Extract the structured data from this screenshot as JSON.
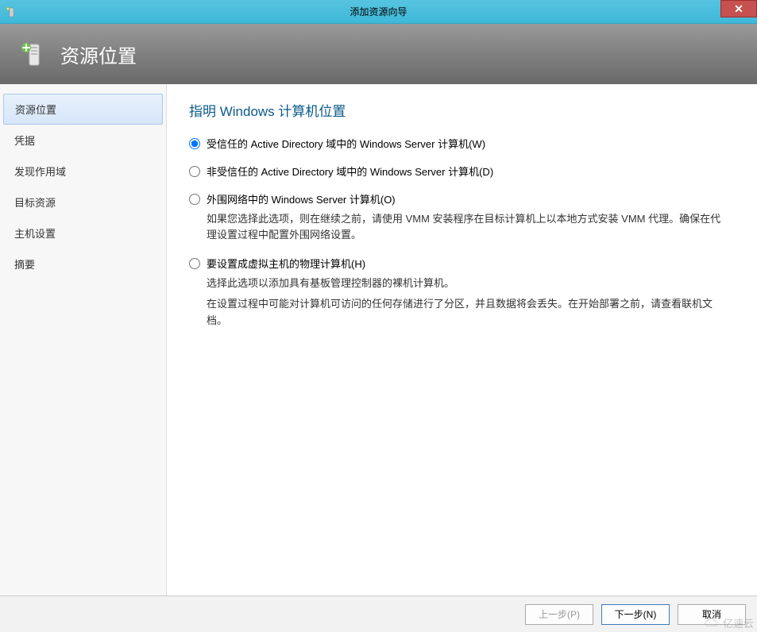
{
  "titlebar": {
    "title": "添加资源向导"
  },
  "header": {
    "title": "资源位置"
  },
  "sidebar": {
    "items": [
      {
        "label": "资源位置",
        "active": true
      },
      {
        "label": "凭据",
        "active": false
      },
      {
        "label": "发现作用域",
        "active": false
      },
      {
        "label": "目标资源",
        "active": false
      },
      {
        "label": "主机设置",
        "active": false
      },
      {
        "label": "摘要",
        "active": false
      }
    ]
  },
  "content": {
    "heading": "指明 Windows 计算机位置",
    "options": [
      {
        "label": "受信任的 Active Directory 域中的 Windows Server 计算机(W)",
        "selected": true,
        "desc": ""
      },
      {
        "label": "非受信任的 Active Directory 域中的 Windows Server 计算机(D)",
        "selected": false,
        "desc": ""
      },
      {
        "label": "外围网络中的 Windows Server 计算机(O)",
        "selected": false,
        "desc": "如果您选择此选项，则在继续之前，请使用 VMM 安装程序在目标计算机上以本地方式安装 VMM 代理。确保在代理设置过程中配置外围网络设置。"
      },
      {
        "label": "要设置成虚拟主机的物理计算机(H)",
        "selected": false,
        "desc": "选择此选项以添加具有基板管理控制器的裸机计算机。",
        "desc2": "在设置过程中可能对计算机可访问的任何存储进行了分区，并且数据将会丢失。在开始部署之前，请查看联机文档。"
      }
    ]
  },
  "footer": {
    "previous": "上一步(P)",
    "next": "下一步(N)",
    "cancel": "取消"
  },
  "watermark": {
    "text": "亿速云"
  }
}
